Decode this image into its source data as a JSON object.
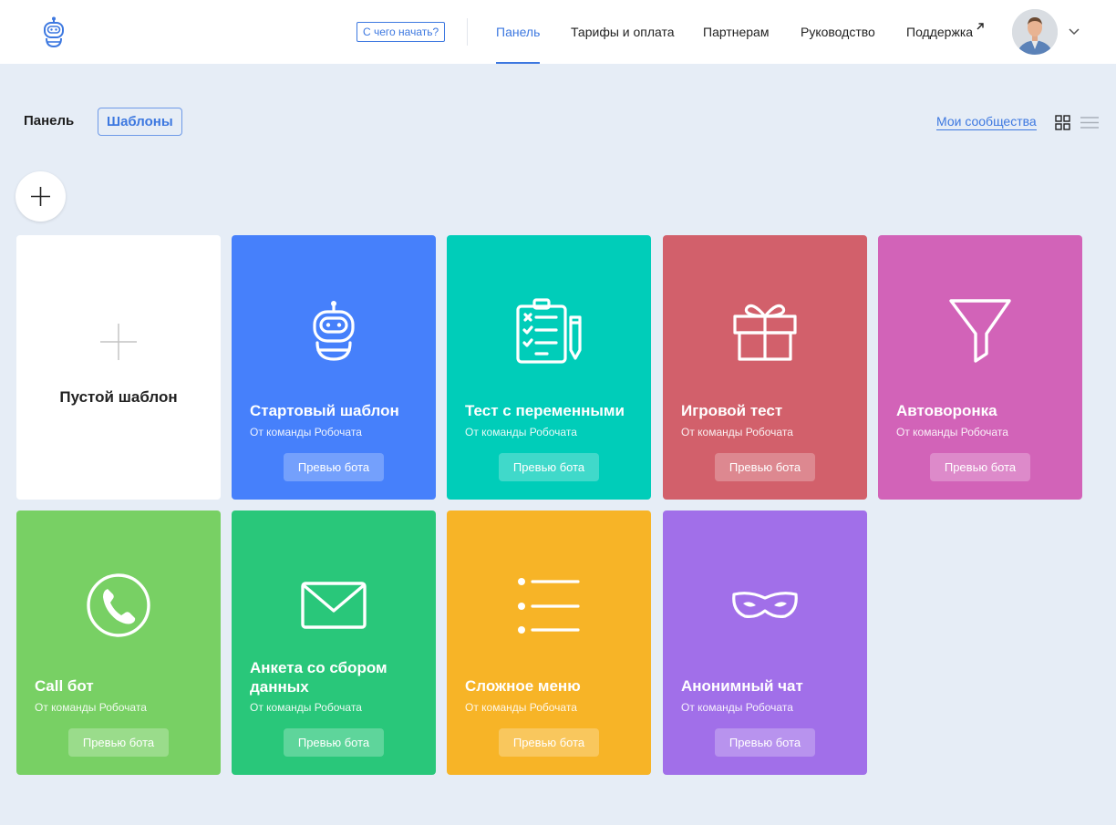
{
  "header": {
    "start_button": "С чего начать?",
    "nav": [
      {
        "label": "Панель",
        "active": true
      },
      {
        "label": "Тарифы и оплата"
      },
      {
        "label": "Партнерам"
      },
      {
        "label": "Руководство"
      },
      {
        "label": "Поддержка"
      }
    ]
  },
  "subheader": {
    "panel": "Панель",
    "templates": "Шаблоны",
    "communities": "Мои сообщества"
  },
  "empty_card": {
    "title": "Пустой шаблон"
  },
  "cards": [
    {
      "title": "Стартовый шаблон",
      "subtitle": "От команды Робочата",
      "button": "Превью бота",
      "color": "#4680fb",
      "icon": "robot-icon"
    },
    {
      "title": "Тест с переменными",
      "subtitle": "От команды Робочата",
      "button": "Превью бота",
      "color": "#00cdb9",
      "icon": "clipboard-checklist-icon"
    },
    {
      "title": "Игровой тест",
      "subtitle": "От команды Робочата",
      "button": "Превью бота",
      "color": "#d2606b",
      "icon": "gift-icon"
    },
    {
      "title": "Автоворонка",
      "subtitle": "От команды Робочата",
      "button": "Превью бота",
      "color": "#d263b8",
      "icon": "funnel-icon"
    },
    {
      "title": "Call бот",
      "subtitle": "От команды Робочата",
      "button": "Превью бота",
      "color": "#78d064",
      "icon": "phone-icon"
    },
    {
      "title": "Анкета со сбором данных",
      "subtitle": "От команды Робочата",
      "button": "Превью бота",
      "color": "#29c77a",
      "icon": "envelope-icon"
    },
    {
      "title": "Сложное меню",
      "subtitle": "От команды Робочата",
      "button": "Превью бота",
      "color": "#f7b427",
      "icon": "list-menu-icon"
    },
    {
      "title": "Анонимный чат",
      "subtitle": "От команды Робочата",
      "button": "Превью бота",
      "color": "#a16fe9",
      "icon": "mask-icon"
    }
  ]
}
